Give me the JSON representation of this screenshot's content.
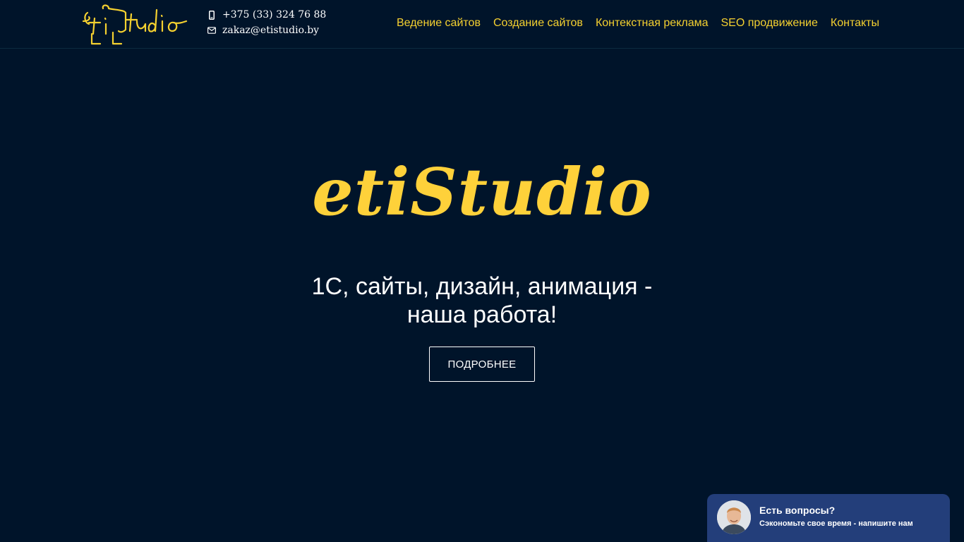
{
  "header": {
    "logo": {
      "text": "etiStudio",
      "color": "#f5d130",
      "icon": "etistudio-logo"
    },
    "contacts": {
      "phone": "+375 (33) 324 76 88",
      "phone_icon": "mobile-phone-icon",
      "email": "zakaz@etistudio.by",
      "email_icon": "envelope-icon"
    },
    "nav": [
      {
        "label": "Ведение сайтов"
      },
      {
        "label": "Создание сайтов"
      },
      {
        "label": "Контекстная реклама"
      },
      {
        "label": "SEO продвижение"
      },
      {
        "label": "Контакты"
      }
    ],
    "nav_color": "#f5d130"
  },
  "hero": {
    "title": "etiStudio",
    "subtitle_line1": "1С, сайты, дизайн, анимация -",
    "subtitle_line2": "наша работа!",
    "button_label": "ПОДРОБНЕЕ",
    "title_color": "#fed13a",
    "background": "#00142a"
  },
  "chat": {
    "title": "Есть вопросы?",
    "text": "Сэкономьте свое время - напишите нам",
    "background": "#233e7a",
    "avatar_icon": "operator-avatar"
  }
}
